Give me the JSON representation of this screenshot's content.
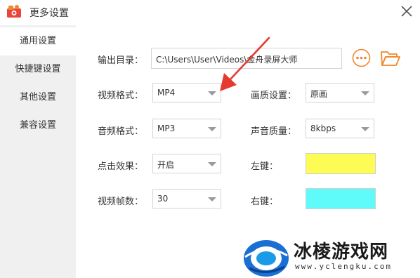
{
  "window": {
    "title": "更多设置"
  },
  "sidebar": {
    "items": [
      {
        "label": "通用设置",
        "active": true
      },
      {
        "label": "快捷键设置",
        "active": false
      },
      {
        "label": "其他设置",
        "active": false
      },
      {
        "label": "兼容设置",
        "active": false
      }
    ]
  },
  "settings": {
    "output_dir": {
      "label": "输出目录：",
      "value": "C:\\Users\\User\\Videos\\金舟录屏大师"
    },
    "video_format": {
      "label": "视频格式：",
      "value": "MP4"
    },
    "quality": {
      "label": "画质设置：",
      "value": "原画"
    },
    "audio_format": {
      "label": "音频格式：",
      "value": "MP3"
    },
    "sound_quality": {
      "label": "声音质量：",
      "value": "8kbps"
    },
    "click_effect": {
      "label": "点击效果：",
      "value": "开启"
    },
    "left_key": {
      "label": "左键：",
      "color": "#fdfc55"
    },
    "frame_rate": {
      "label": "视频帧数：",
      "value": "30"
    },
    "right_key": {
      "label": "右键：",
      "color": "#5ffbfb"
    }
  },
  "icons": {
    "app": "camera-icon",
    "close": "close-icon",
    "more": "more-options-icon",
    "folder": "folder-icon"
  },
  "colors": {
    "accent_orange": "#f0872c",
    "annotation_red": "#e53a2f"
  },
  "watermark": {
    "title": "冰棱游戏网",
    "url": "www.yclengku.com"
  }
}
